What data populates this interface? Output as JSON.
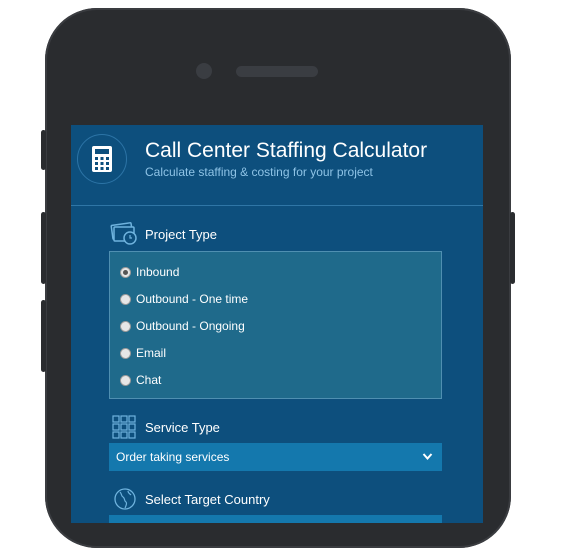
{
  "app": {
    "title": "Call Center Staffing Calculator",
    "subtitle": "Calculate staffing & costing for your project"
  },
  "project_type": {
    "label": "Project Type",
    "options": [
      {
        "label": "Inbound",
        "checked": true
      },
      {
        "label": "Outbound - One time",
        "checked": false
      },
      {
        "label": "Outbound - Ongoing",
        "checked": false
      },
      {
        "label": "Email",
        "checked": false
      },
      {
        "label": "Chat",
        "checked": false
      }
    ]
  },
  "service_type": {
    "label": "Service Type",
    "selected": "Order taking services"
  },
  "target_country": {
    "label": "Select Target Country"
  },
  "colors": {
    "screen_bg": "#0d4f7d",
    "accent": "#1478ad",
    "panel": "#1f6a8b",
    "phone_body": "#2a2c2f"
  },
  "icons": [
    "calculator-icon",
    "money-clock-icon",
    "grid-icon",
    "globe-icon",
    "chevron-down-icon"
  ]
}
